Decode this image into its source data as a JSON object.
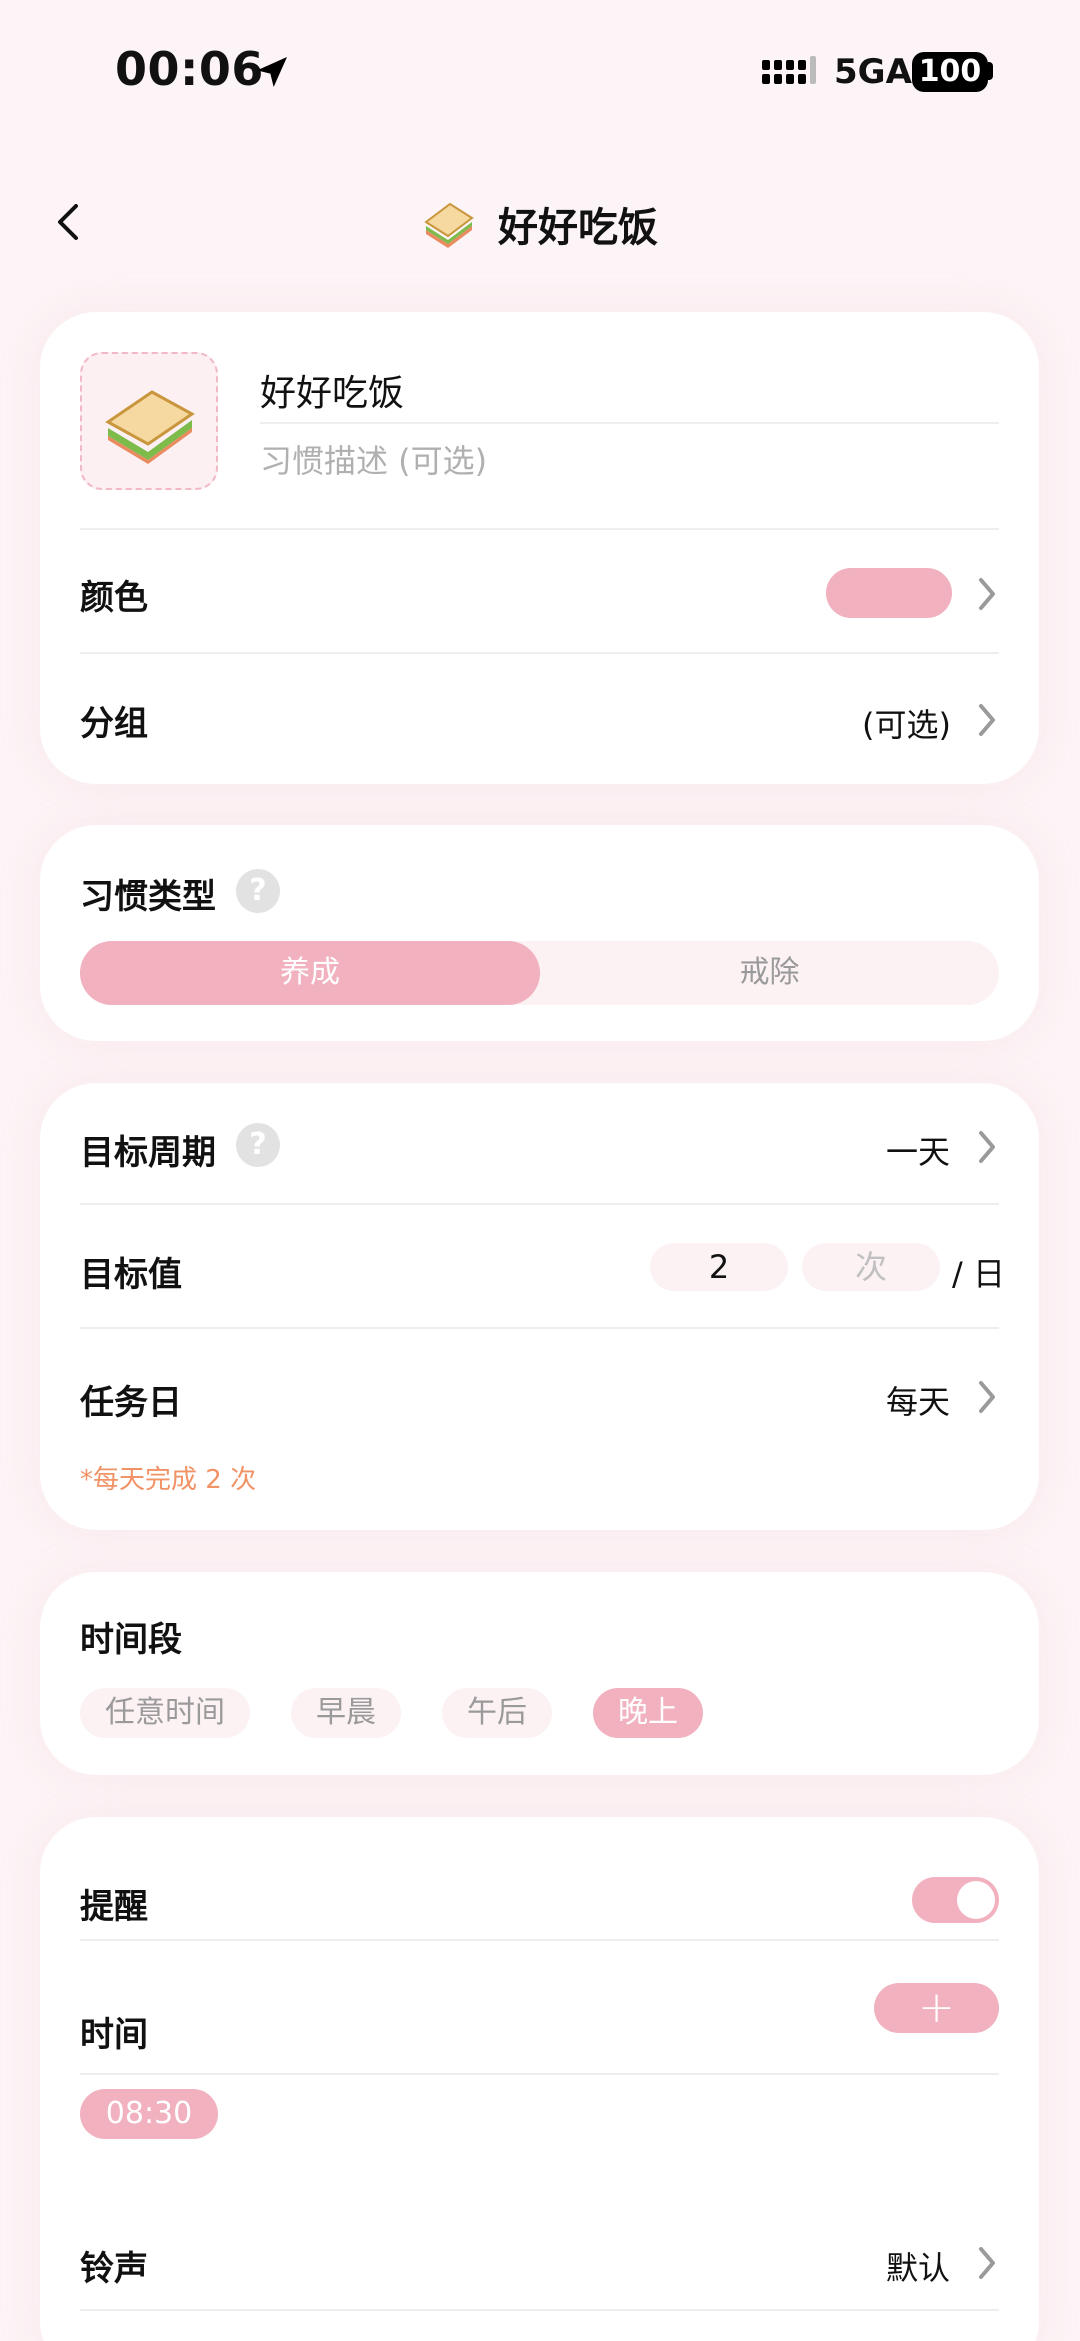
{
  "status_bar": {
    "time": "00:06",
    "network": "5GA",
    "battery": "100"
  },
  "header": {
    "title": "好好吃饭",
    "emoji": "🥪",
    "back_icon": "chevron-left-icon"
  },
  "basic_card": {
    "habit_name": "好好吃饭",
    "description_placeholder": "习惯描述 (可选)",
    "color_label": "颜色",
    "color_value": "#f1b1bf",
    "group_label": "分组",
    "group_value": "(可选)"
  },
  "type_card": {
    "label": "习惯类型",
    "help": "?",
    "options": [
      "养成",
      "戒除"
    ],
    "selected": "养成"
  },
  "goal_card": {
    "period_label": "目标周期",
    "period_value": "一天",
    "goal_label": "目标值",
    "goal_value": "2",
    "goal_unit_placeholder": "次",
    "goal_per": "/ 日",
    "taskday_label": "任务日",
    "taskday_value": "每天",
    "hint": "*每天完成 2 次"
  },
  "timeslot_card": {
    "label": "时间段",
    "options": [
      "任意时间",
      "早晨",
      "午后",
      "晚上"
    ],
    "selected": "晚上"
  },
  "reminder_card": {
    "remind_label": "提醒",
    "remind_on": true,
    "time_label": "时间",
    "add_symbol": "+",
    "times": [
      "08:30"
    ],
    "ringtone_label": "铃声",
    "ringtone_value": "默认"
  },
  "colors": {
    "accent": "#f1b1bf",
    "background": "#fcf4f6",
    "hint": "#f19366"
  }
}
